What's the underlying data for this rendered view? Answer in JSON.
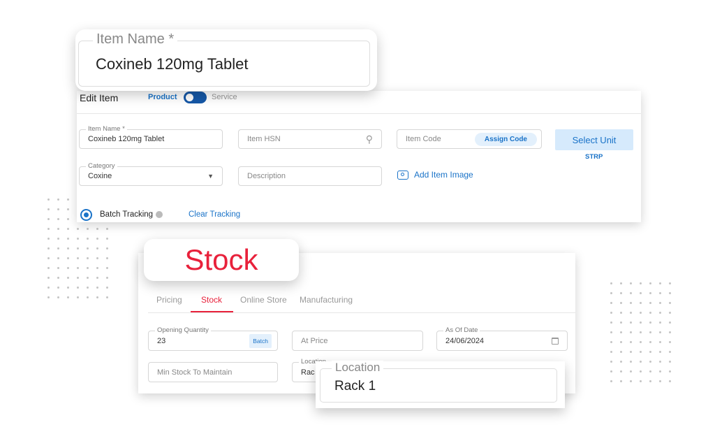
{
  "item_name_callout": {
    "label": "Item Name *",
    "value": "Coxineb 120mg Tablet"
  },
  "edit_item": {
    "title": "Edit Item",
    "toggle": {
      "left": "Product",
      "right": "Service",
      "selected": "Product"
    },
    "item_name": {
      "label": "Item Name *",
      "value": "Coxineb 120mg Tablet"
    },
    "item_hsn": {
      "placeholder": "Item HSN"
    },
    "item_code": {
      "placeholder": "Item Code",
      "assign_label": "Assign Code"
    },
    "select_unit": {
      "label": "Select Unit",
      "unit": "STRP"
    },
    "category": {
      "label": "Category",
      "value": "Coxine"
    },
    "description": {
      "placeholder": "Description"
    },
    "add_image": "Add Item Image",
    "batch_tracking": "Batch Tracking",
    "clear_tracking": "Clear Tracking"
  },
  "stock_callout": {
    "title": "Stock"
  },
  "stock": {
    "tabs": [
      "Pricing",
      "Stock",
      "Online Store",
      "Manufacturing"
    ],
    "active_tab": "Stock",
    "opening_qty": {
      "label": "Opening Quantity",
      "value": "23",
      "batch_label": "Batch"
    },
    "at_price": {
      "placeholder": "At Price"
    },
    "as_of_date": {
      "label": "As Of Date",
      "value": "24/06/2024"
    },
    "min_stock": {
      "placeholder": "Min Stock To Maintain"
    },
    "location": {
      "label": "Location",
      "value": "Rac"
    }
  },
  "location_callout": {
    "label": "Location",
    "value": "Rack 1"
  },
  "colors": {
    "accent": "#1a73c8",
    "stock_red": "#e8213b"
  }
}
